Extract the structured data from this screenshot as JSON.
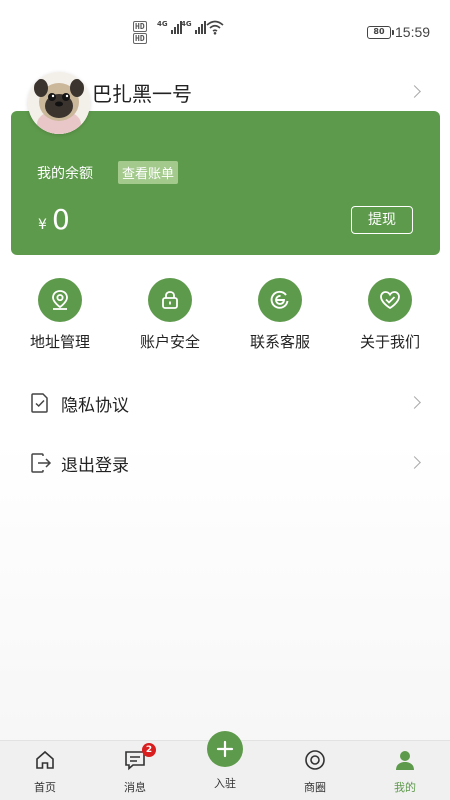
{
  "status_bar": {
    "sim1": "HD",
    "sim2": "HD",
    "net1": "4G",
    "net2": "4G",
    "battery": "80",
    "time": "15:59"
  },
  "profile": {
    "username": "巴扎黑一号",
    "avatar_icon": "pug-avatar"
  },
  "balance": {
    "label": "我的余额",
    "bill_link": "查看账单",
    "currency": "¥",
    "amount": "0",
    "withdraw": "提现"
  },
  "actions": [
    {
      "label": "地址管理",
      "icon": "location-icon"
    },
    {
      "label": "账户安全",
      "icon": "lock-icon"
    },
    {
      "label": "联系客服",
      "icon": "service-icon"
    },
    {
      "label": "关于我们",
      "icon": "heart-check-icon"
    }
  ],
  "menu": [
    {
      "label": "隐私协议",
      "icon": "document-check-icon"
    },
    {
      "label": "退出登录",
      "icon": "logout-icon"
    }
  ],
  "tabbar": {
    "tabs": [
      {
        "label": "首页",
        "icon": "home-icon"
      },
      {
        "label": "消息",
        "icon": "message-icon",
        "badge": "2"
      },
      {
        "label": "入驻",
        "icon": "plus-icon"
      },
      {
        "label": "商圈",
        "icon": "target-icon"
      },
      {
        "label": "我的",
        "icon": "person-icon",
        "active": true
      }
    ]
  },
  "colors": {
    "accent": "#5e9a4c",
    "badge": "#d81e1e",
    "tag_bg": "#a3c98d"
  }
}
